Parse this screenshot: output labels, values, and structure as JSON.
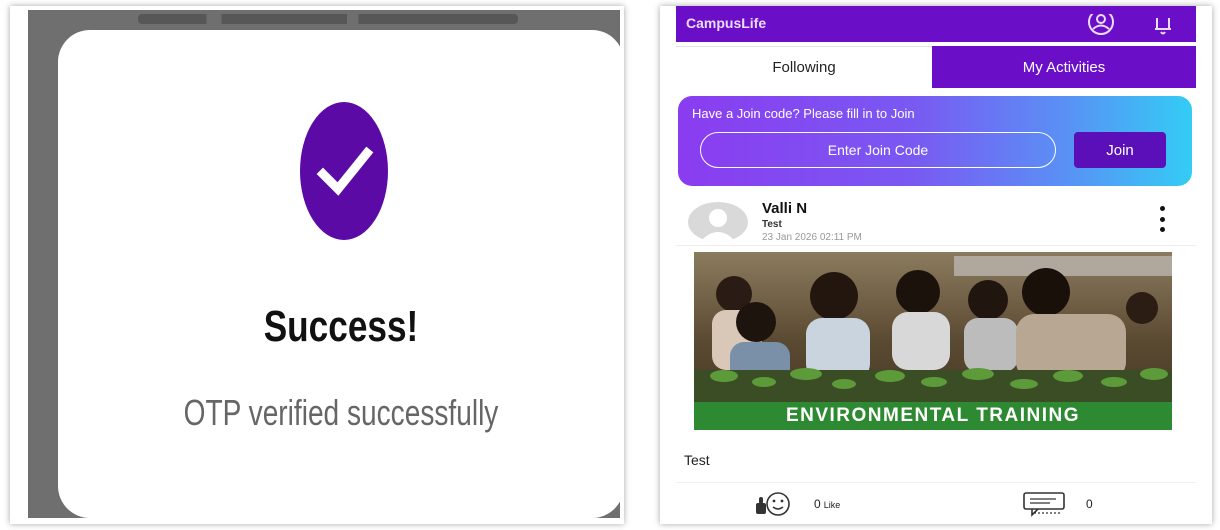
{
  "otp_dialog": {
    "title": "Success!",
    "message": "OTP verified successfully",
    "icon": "check-circle-icon",
    "accent_color": "#5b0aa6"
  },
  "app": {
    "title": "CampusLife",
    "header_icons": [
      "profile-icon",
      "bell-icon"
    ],
    "brand_color": "#6a0fc7"
  },
  "tabs": [
    {
      "label": "Following",
      "active": true
    },
    {
      "label": "My Activities",
      "active": false
    }
  ],
  "join": {
    "prompt": "Have a Join code? Please fill in to Join",
    "input_value": "",
    "input_placeholder": "Enter Join Code",
    "button_label": "Join"
  },
  "post": {
    "author": "Valli N",
    "subtitle": "Test",
    "timestamp": "23 Jan 2026 02:11 PM",
    "image_banner": "ENVIRONMENTAL TRAINING",
    "text": "Test",
    "likes": {
      "count": "0",
      "label": "Like"
    },
    "comments": {
      "count": "0"
    }
  }
}
